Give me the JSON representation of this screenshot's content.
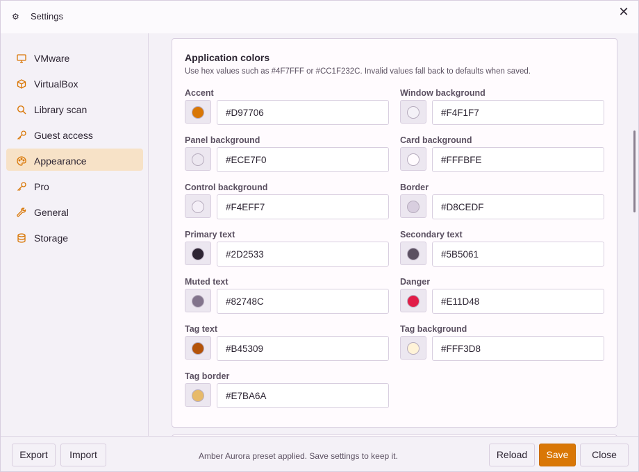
{
  "window": {
    "title": "Settings",
    "close_glyph": "✕",
    "app_icon": "⚙"
  },
  "sidebar": {
    "items": [
      {
        "label": "VMware",
        "icon": "monitor-icon",
        "active": false
      },
      {
        "label": "VirtualBox",
        "icon": "box-icon",
        "active": false
      },
      {
        "label": "Library scan",
        "icon": "search-icon",
        "active": false
      },
      {
        "label": "Guest access",
        "icon": "key-icon",
        "active": false
      },
      {
        "label": "Appearance",
        "icon": "palette-icon",
        "active": true
      },
      {
        "label": "Pro",
        "icon": "key-icon",
        "active": false
      },
      {
        "label": "General",
        "icon": "wrench-icon",
        "active": false
      },
      {
        "label": "Storage",
        "icon": "database-icon",
        "active": false
      }
    ]
  },
  "card": {
    "title": "Application colors",
    "description": "Use hex values such as #4F7FFF or #CC1F232C. Invalid values fall back to defaults when saved."
  },
  "colors": [
    {
      "label": "Accent",
      "value": "#D97706",
      "swatch": "#D97706"
    },
    {
      "label": "Window background",
      "value": "#F4F1F7",
      "swatch": "#F4F1F7"
    },
    {
      "label": "Panel background",
      "value": "#ECE7F0",
      "swatch": "#ECE7F0"
    },
    {
      "label": "Card background",
      "value": "#FFFBFE",
      "swatch": "#FFFBFE"
    },
    {
      "label": "Control background",
      "value": "#F4EFF7",
      "swatch": "#F4EFF7"
    },
    {
      "label": "Border",
      "value": "#D8CEDF",
      "swatch": "#D8CEDF"
    },
    {
      "label": "Primary text",
      "value": "#2D2533",
      "swatch": "#2D2533"
    },
    {
      "label": "Secondary text",
      "value": "#5B5061",
      "swatch": "#5B5061"
    },
    {
      "label": "Muted text",
      "value": "#82748C",
      "swatch": "#82748C"
    },
    {
      "label": "Danger",
      "value": "#E11D48",
      "swatch": "#E11D48"
    },
    {
      "label": "Tag text",
      "value": "#B45309",
      "swatch": "#B45309"
    },
    {
      "label": "Tag background",
      "value": "#FFF3D8",
      "swatch": "#FFF3D8"
    },
    {
      "label": "Tag border",
      "value": "#E7BA6A",
      "swatch": "#E7BA6A"
    }
  ],
  "footer": {
    "export_label": "Export",
    "import_label": "Import",
    "status": "Amber Aurora preset applied. Save settings to keep it.",
    "reload_label": "Reload",
    "save_label": "Save",
    "close_label": "Close"
  },
  "theme": {
    "accent": "#D97706"
  }
}
